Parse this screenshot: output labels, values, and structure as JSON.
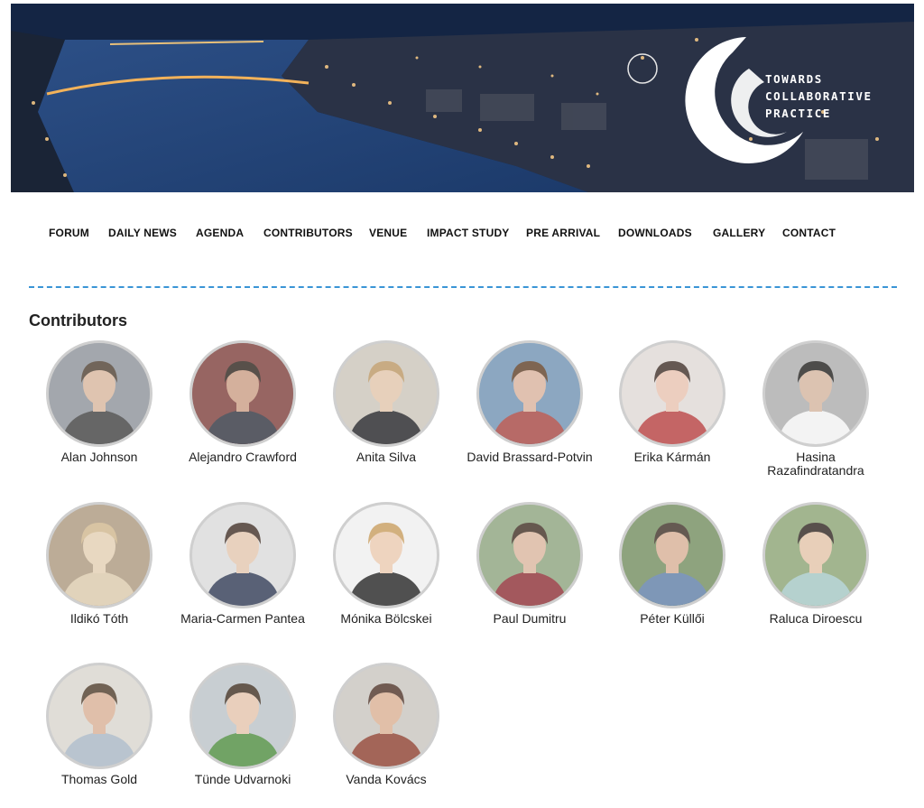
{
  "banner": {
    "logo_lines": [
      "TOWARDS",
      "COLLABORATIVE",
      "PRACTICE"
    ]
  },
  "nav": {
    "items": [
      {
        "label": "FORUM"
      },
      {
        "label": "DAILY NEWS"
      },
      {
        "label": "AGENDA"
      },
      {
        "label": "CONTRIBUTORS"
      },
      {
        "label": "VENUE"
      },
      {
        "label": "IMPACT STUDY"
      },
      {
        "label": "PRE ARRIVAL"
      },
      {
        "label": "DOWNLOADS"
      },
      {
        "label": "GALLERY"
      },
      {
        "label": "CONTACT"
      }
    ]
  },
  "page": {
    "title": "Contributors"
  },
  "contributors": [
    {
      "name": "Alan Johnson",
      "bg": "#8a8f96",
      "skin": "#d6b49a",
      "shirt": "#3b3b3b",
      "hair": "#4a3a2c"
    },
    {
      "name": "Alejandro Crawford",
      "bg": "#7a3a36",
      "skin": "#c89a80",
      "shirt": "#2c2f3a",
      "hair": "#2a1f18"
    },
    {
      "name": "Anita Silva",
      "bg": "#c9c3b8",
      "skin": "#e1c3a8",
      "shirt": "#1e1e22",
      "hair": "#b99461"
    },
    {
      "name": "David Brassard-Potvin",
      "bg": "#6c8fb0",
      "skin": "#d8b09a",
      "shirt": "#a3403d",
      "hair": "#5a3a22"
    },
    {
      "name": "Erika Kármán",
      "bg": "#ded8d4",
      "skin": "#e7c0ad",
      "shirt": "#b43a3a",
      "hair": "#3a2a22"
    },
    {
      "name": "Hasina Razafindratandra",
      "bg": "#a9a9a9",
      "skin": "#d2b29c",
      "shirt": "#f0f0f0",
      "hair": "#1c1a18"
    },
    {
      "name": "Ildikó Tóth",
      "bg": "#a9957a",
      "skin": "#e2cdb0",
      "shirt": "#d9c7a8",
      "hair": "#cdb489"
    },
    {
      "name": "Maria-Carmen Pantea",
      "bg": "#d9d9d9",
      "skin": "#e2c4ac",
      "shirt": "#2b3550",
      "hair": "#3b2a20"
    },
    {
      "name": "Mónika Bölcskei",
      "bg": "#efefef",
      "skin": "#e9c8ad",
      "shirt": "#1f1f1f",
      "hair": "#c69a5a"
    },
    {
      "name": "Paul Dumitru",
      "bg": "#8aa07a",
      "skin": "#d9b49b",
      "shirt": "#8a2a30",
      "hair": "#3b2a1e"
    },
    {
      "name": "Péter Küllői",
      "bg": "#6f8a5a",
      "skin": "#d6ad93",
      "shirt": "#5a7aa3",
      "hair": "#3a2c22"
    },
    {
      "name": "Raluca Diroescu",
      "bg": "#88a070",
      "skin": "#e2c2a6",
      "shirt": "#a0c5c0",
      "hair": "#2a1f1a"
    },
    {
      "name": "Thomas Gold",
      "bg": "#d8d4cc",
      "skin": "#d8ae92",
      "shirt": "#a6b4c2",
      "hair": "#4a3624"
    },
    {
      "name": "Tünde Udvarnoki",
      "bg": "#b9c1c6",
      "skin": "#e3c2a9",
      "shirt": "#4a8a3a",
      "hair": "#3a2a1c"
    },
    {
      "name": "Vanda Kovács",
      "bg": "#c7c3bd",
      "skin": "#d9ae90",
      "shirt": "#8a3a2a",
      "hair": "#4a2e22"
    }
  ]
}
